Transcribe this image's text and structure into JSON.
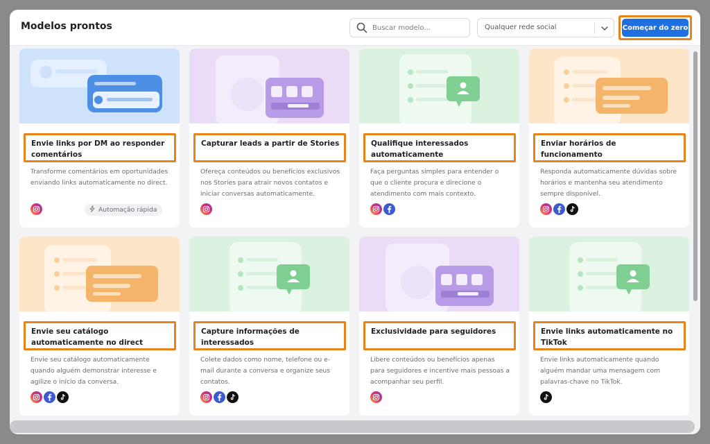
{
  "header": {
    "title": "Modelos prontos",
    "search_placeholder": "Buscar modelo...",
    "filter_value": "Qualquer rede social",
    "start_button": "Começar do zero"
  },
  "colors": {
    "accent": "#1e6fe0",
    "highlight": "#e8821a",
    "blue_bg": "#cfe2fb",
    "purple_bg": "#eadcf7",
    "green_bg": "#dbf2e0",
    "orange_bg": "#fde5c8"
  },
  "cards": [
    {
      "title": "Envie links por DM ao responder comentários",
      "description": "Transforme comentários em oportunidades enviando links automaticamente no direct.",
      "socials": [
        "instagram"
      ],
      "badge": "Automação rápida",
      "theme": "blue",
      "illustration": "link-card-icon"
    },
    {
      "title": "Capturar leads a partir de Stories",
      "description": "Ofereça conteúdos ou benefícios exclusivos nos Stories para atrair novos contatos e iniciar conversas automaticamente.",
      "socials": [
        "instagram"
      ],
      "theme": "purple",
      "illustration": "story-icon"
    },
    {
      "title": "Qualifique interessados automaticamente",
      "description": "Faça perguntas simples para entender o que o cliente procura e direcione o atendimento com mais contexto.",
      "socials": [
        "instagram",
        "facebook"
      ],
      "theme": "green",
      "illustration": "profile-chat-icon"
    },
    {
      "title": "Enviar horários de funcionamento",
      "description": "Responda automaticamente dúvidas sobre horários e mantenha seu atendimento sempre disponível.",
      "socials": [
        "instagram",
        "facebook",
        "tiktok"
      ],
      "theme": "orange",
      "illustration": "list-card-icon"
    },
    {
      "title": "Envie seu catálogo automaticamente no direct",
      "description": "Envie seu catálogo automaticamente quando alguém demonstrar interesse e agilize o início da conversa.",
      "socials": [
        "instagram",
        "facebook",
        "tiktok"
      ],
      "theme": "orange",
      "illustration": "list-card-icon"
    },
    {
      "title": "Capture informações de interessados",
      "description": "Colete dados como nome, telefone ou e-mail durante a conversa e organize seus contatos.",
      "socials": [
        "instagram",
        "facebook",
        "tiktok"
      ],
      "theme": "green",
      "illustration": "profile-chat-icon"
    },
    {
      "title": "Exclusividade para seguidores",
      "description": "Libere conteúdos ou benefícios apenas para seguidores e incentive mais pessoas a acompanhar seu perfil.",
      "socials": [
        "instagram"
      ],
      "theme": "purple",
      "illustration": "story-icon"
    },
    {
      "title": "Envie links automaticamente no TikTok",
      "description": "Envie links automaticamente quando alguém mandar uma mensagem com palavras-chave no TikTok.",
      "socials": [
        "tiktok"
      ],
      "theme": "green",
      "illustration": "profile-chat-icon"
    }
  ]
}
